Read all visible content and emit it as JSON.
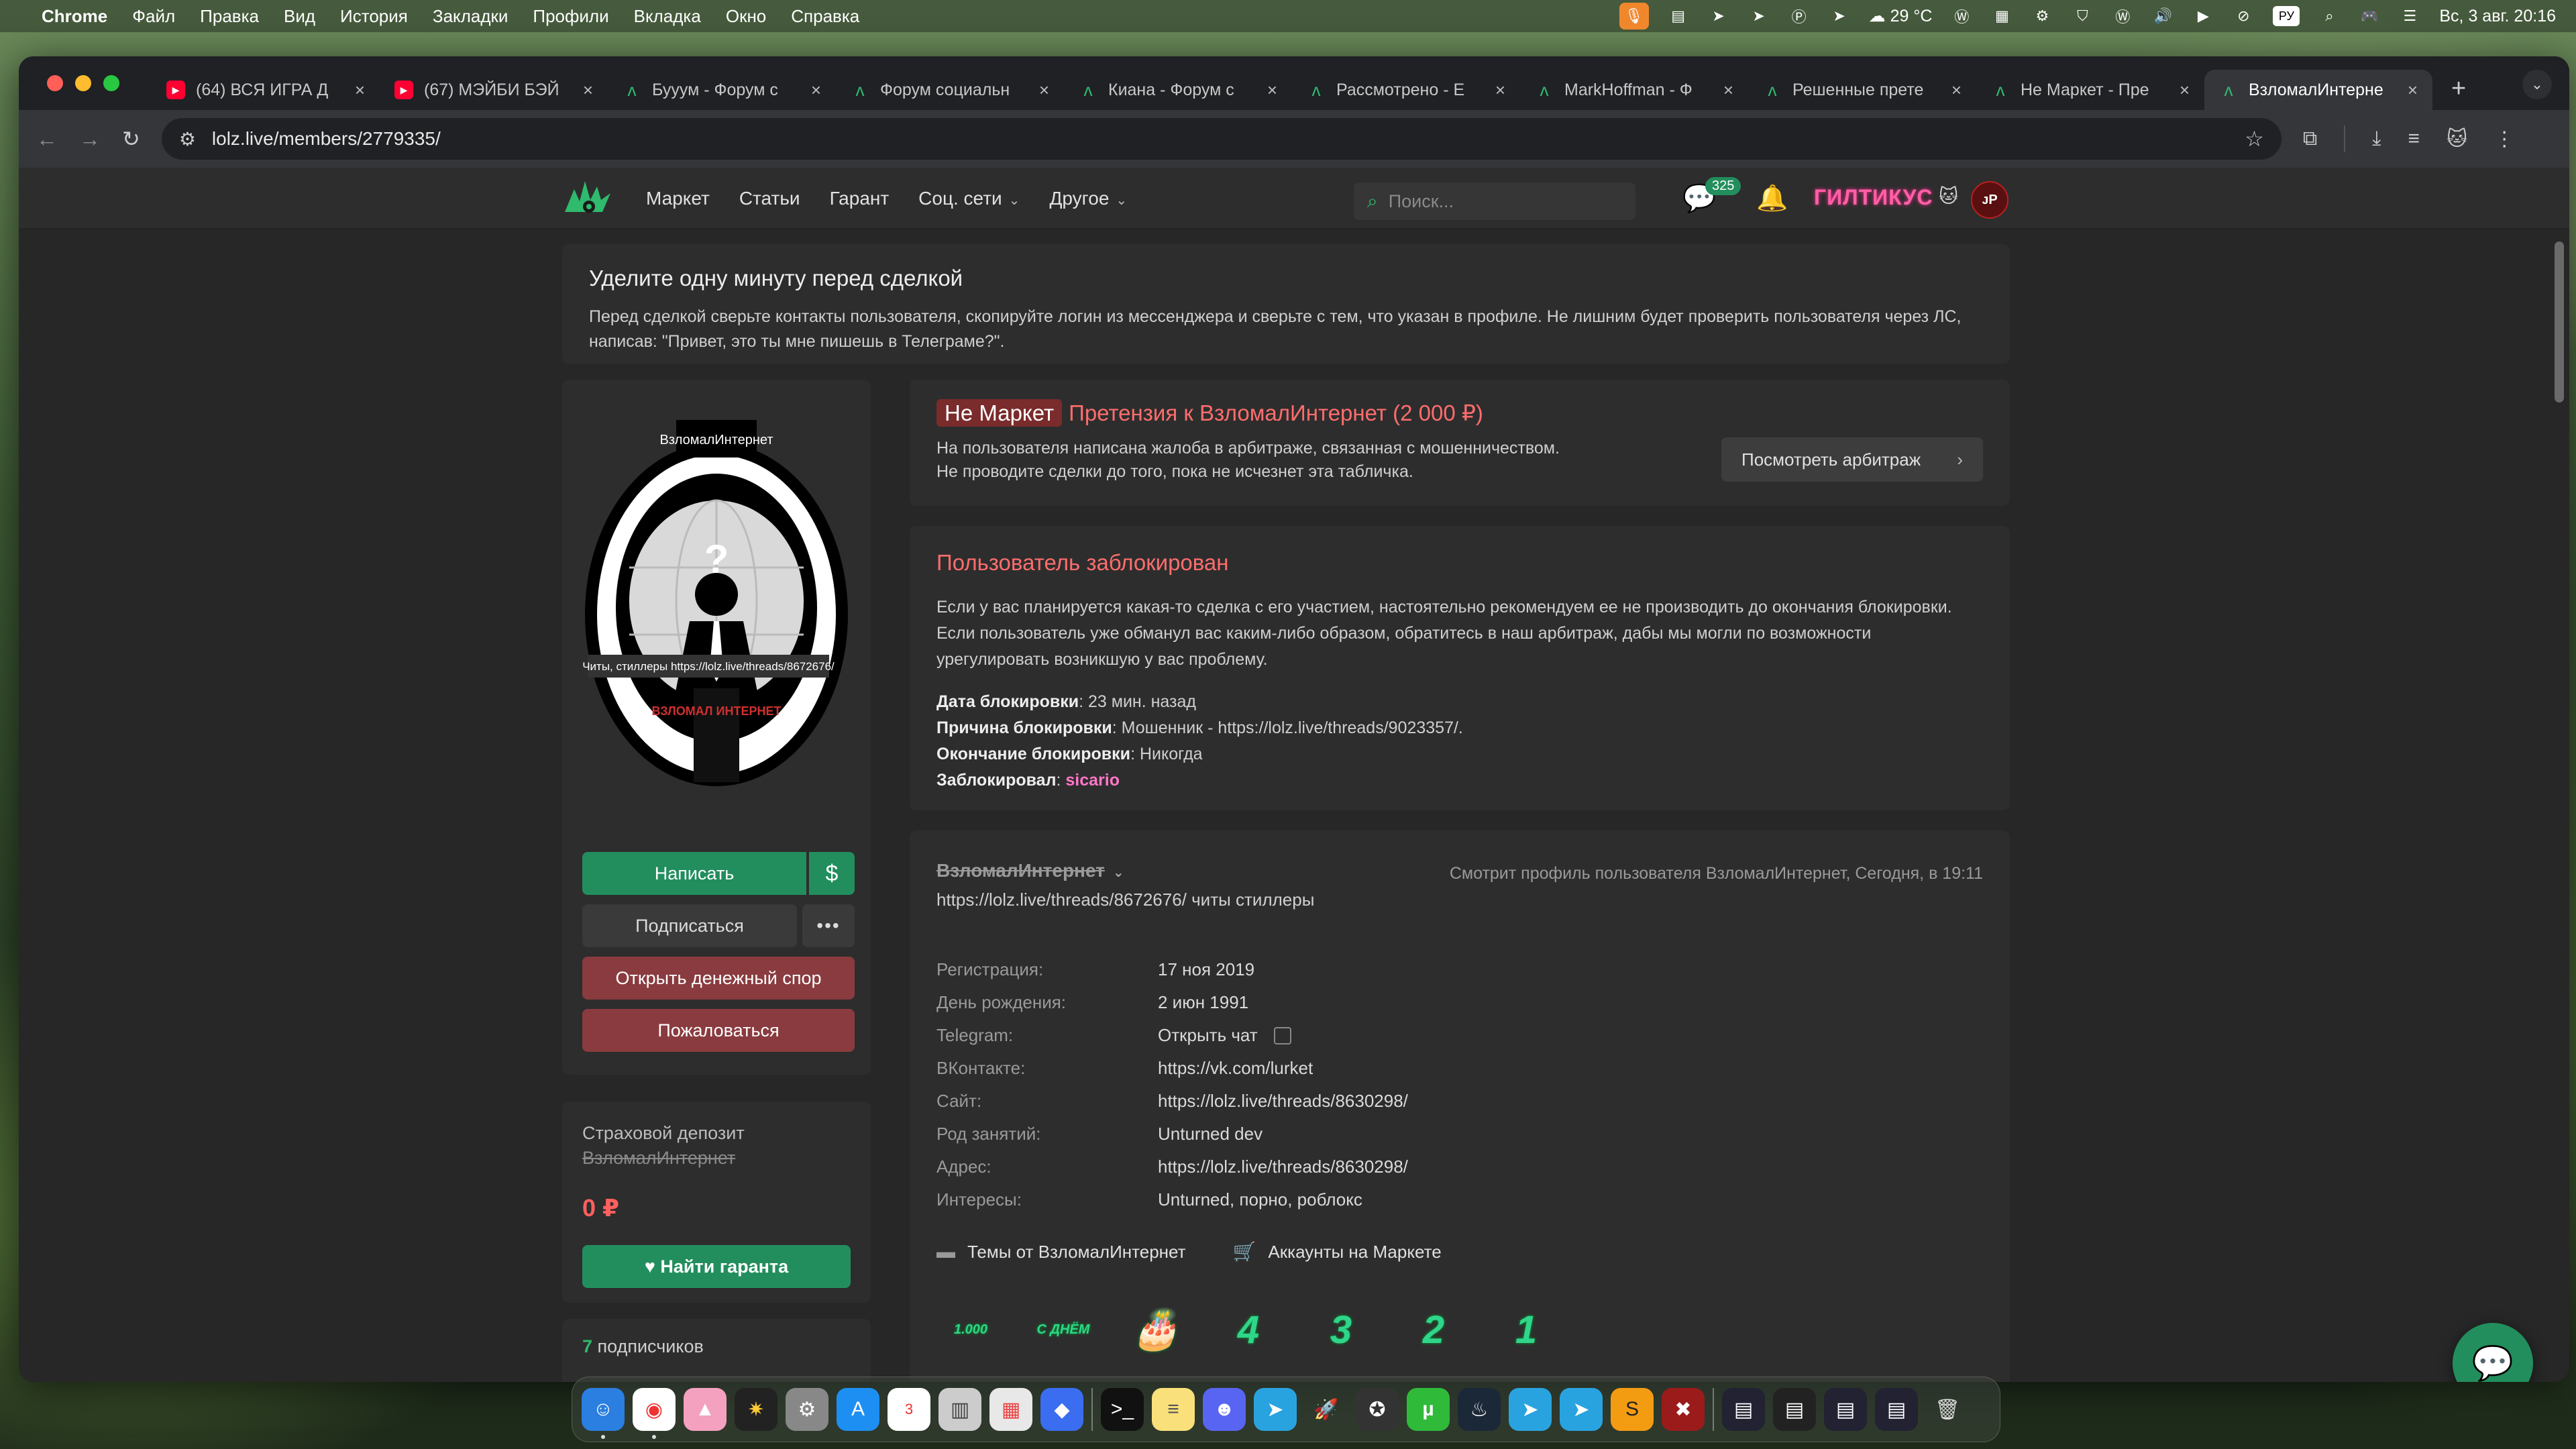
{
  "menubar": {
    "app": "Chrome",
    "items": [
      "Файл",
      "Правка",
      "Вид",
      "История",
      "Закладки",
      "Профили",
      "Вкладка",
      "Окно",
      "Справка"
    ],
    "weather": "29 °C",
    "kbd": "РУ",
    "datetime": "Вс, 3 авг.  20:16"
  },
  "tabs": [
    {
      "title": "(64) ВСЯ ИГРА Д",
      "fav": "yt"
    },
    {
      "title": "(67) МЭЙБИ БЭЙ",
      "fav": "yt"
    },
    {
      "title": "Бууум - Форум с",
      "fav": "lz"
    },
    {
      "title": "Форум социальн",
      "fav": "lz"
    },
    {
      "title": "Киана - Форум с",
      "fav": "lz"
    },
    {
      "title": "Рассмотрено - Е",
      "fav": "lz"
    },
    {
      "title": "MarkHoffman - Ф",
      "fav": "lz"
    },
    {
      "title": "Решенные прете",
      "fav": "lz"
    },
    {
      "title": "Не Маркет - Пре",
      "fav": "lz"
    },
    {
      "title": "ВзломалИнтерне",
      "fav": "lz",
      "active": true
    }
  ],
  "url": "lolz.live/members/2779335/",
  "site": {
    "nav": [
      "Маркет",
      "Статьи",
      "Гарант",
      "Соц. сети",
      "Другое"
    ],
    "search_placeholder": "Поиск...",
    "conv_badge": "325",
    "nick": "ГИЛТИКУС",
    "avatar": "ᴊP"
  },
  "warning": {
    "title": "Уделите одну минуту перед сделкой",
    "text": "Перед сделкой сверьте контакты пользователя, скопируйте логин из мессенджера и сверьте с тем, что указан в профиле. Не лишним будет проверить пользователя через ЛС, написав: \"Привет, это ты мне пишешь в Телеграме?\"."
  },
  "avatar_texts": {
    "top": "ВзломалИнтернет",
    "mid": "Читы, стиллеры https://lolz.live/threads/8672676/",
    "bottom": "ВЗЛОМАЛ ИНТЕРНЕТ"
  },
  "buttons": {
    "write": "Написать",
    "dollar": "$",
    "subscribe": "Подписаться",
    "more": "•••",
    "dispute": "Открыть денежный спор",
    "report": "Пожаловаться",
    "guarantor": "Найти гаранта"
  },
  "deposit": {
    "title": "Страховой депозит",
    "user": "ВзломалИнтернет",
    "amount": "0 ₽"
  },
  "subscribers": {
    "count": "7",
    "label": " подписчиков"
  },
  "claim": {
    "tag": "Не Маркет",
    "title": "Претензия к ВзломалИнтернет (2 000 ₽)",
    "line1": "На пользователя написана жалоба в арбитраже, связанная с мошенничеством.",
    "line2": "Не проводите сделки до того, пока не исчезнет эта табличка.",
    "button": "Посмотреть арбитраж"
  },
  "ban": {
    "title": "Пользователь заблокирован",
    "desc": "Если у вас планируется какая-то сделка с его участием, настоятельно рекомендуем ее не производить до окончания блокировки. Если пользователь уже обманул вас каким-либо образом, обратитесь в наш арбитраж, дабы мы могли по возможности урегулировать возникшую у вас проблему.",
    "date_k": "Дата блокировки",
    "date_v": ": 23 мин. назад",
    "reason_k": "Причина блокировки",
    "reason_v": ": Мошенник - https://lolz.live/threads/9023357/.",
    "end_k": "Окончание блокировки",
    "end_v": ": Никогда",
    "by_k": "Заблокировал",
    "by_sep": ": ",
    "by_v": "sicario"
  },
  "profile": {
    "username": "ВзломалИнтернет",
    "viewing": "Смотрит профиль пользователя ВзломалИнтернет, Сегодня, в 19:11",
    "status": "https://lolz.live/threads/8672676/ читы стиллеры",
    "info": [
      {
        "k": "Регистрация:",
        "v": "17 ноя 2019"
      },
      {
        "k": "День рождения:",
        "v": "2 июн 1991"
      },
      {
        "k": "Telegram:",
        "v": "Открыть чат",
        "copy": true
      },
      {
        "k": "ВКонтакте:",
        "v": "https://vk.com/lurket"
      },
      {
        "k": "Сайт:",
        "v": "https://lolz.live/threads/8630298/"
      },
      {
        "k": "Род занятий:",
        "v": "Unturned dev"
      },
      {
        "k": "Адрес:",
        "v": "https://lolz.live/threads/8630298/"
      },
      {
        "k": "Интересы:",
        "v": "Unturned, порно, роблокс"
      }
    ],
    "link_threads": "Темы от ВзломалИнтернет",
    "link_market": "Аккаунты на Маркете",
    "trophies": [
      "1.000",
      "С ДНЁМ",
      "🎂",
      "4",
      "3",
      "2",
      "1"
    ]
  },
  "colors": {
    "accent": "#228e5d",
    "danger": "#ff6d6d",
    "danger_btn": "#8a3b3f",
    "bg": "#272727",
    "card": "#2d2d2d"
  }
}
